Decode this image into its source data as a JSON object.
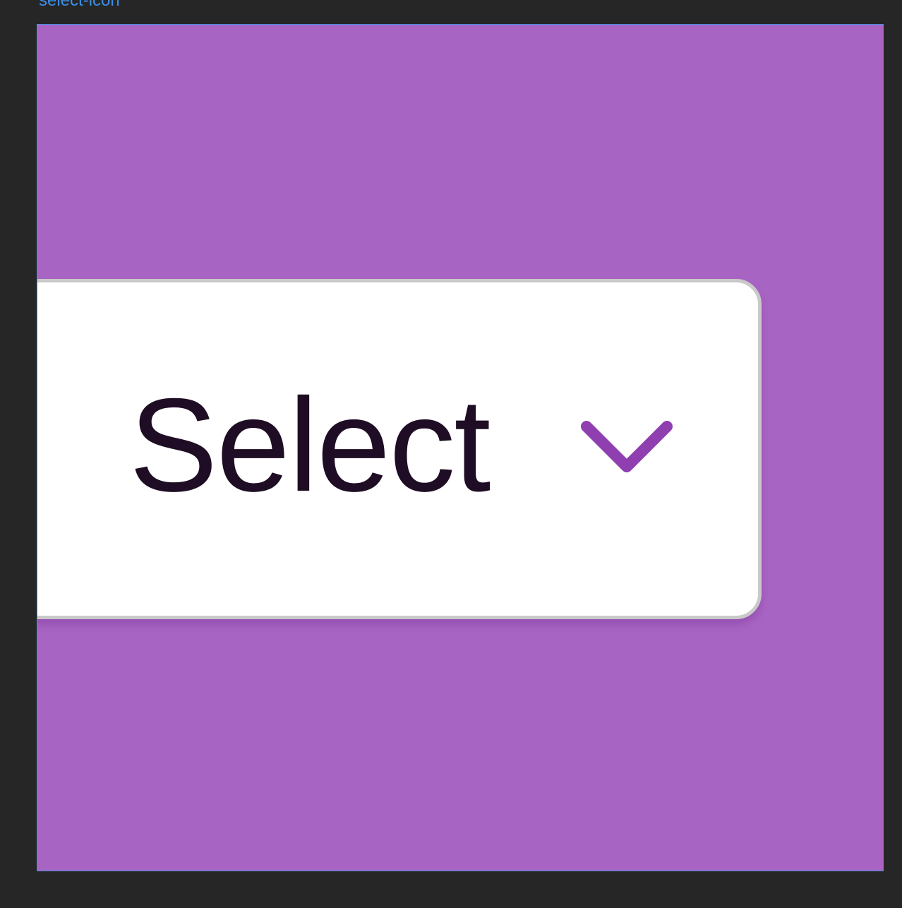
{
  "frame": {
    "label": "select-icon"
  },
  "select": {
    "label": "Select",
    "icon": "chevron-down-icon"
  },
  "colors": {
    "frame_background": "#a864c3",
    "frame_border": "#4a8fe0",
    "label_text": "#3a8fe6",
    "select_background": "#ffffff",
    "select_border": "#c9c9c9",
    "select_text": "#1e0d24",
    "chevron": "#8f3fb0",
    "canvas_background": "#262626"
  }
}
